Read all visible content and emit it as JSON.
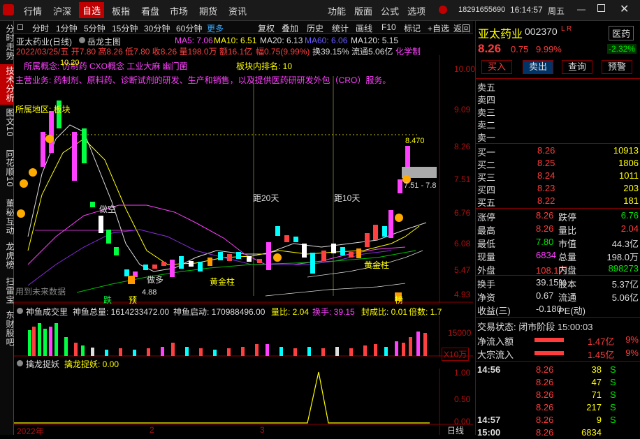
{
  "menu": {
    "items": [
      "行情",
      "沪深",
      "自选",
      "板指",
      "看盘",
      "市场",
      "期货",
      "资讯"
    ],
    "right": [
      "功能",
      "版面",
      "公式",
      "选项"
    ],
    "phone": "18291655690",
    "time": "16:14:57",
    "weekday": "周五"
  },
  "sidebar": [
    "分时走势",
    "技术分析",
    "图文10",
    "同花顺10",
    "董秘互动",
    "龙虎榜",
    "扫雷宝",
    "东财股吧"
  ],
  "timeframes": [
    "分时",
    "1分钟",
    "5分钟",
    "15分钟",
    "30分钟",
    "60分钟",
    "更多"
  ],
  "toolbar": [
    "复权",
    "叠加",
    "历史",
    "统计",
    "画线",
    "F10",
    "标记",
    "+自选",
    "返回"
  ],
  "chart": {
    "title": "亚太药业(日线)",
    "main_indicator": "岳龙主图",
    "ma5": "MA5: 7.06",
    "ma10": "MA10: 6.51",
    "ma20": "MA20: 6.13",
    "ma60": "MA60: 6.06",
    "ma120": "MA120: 5.15",
    "ohlc": "2022/03/25/五 开7.80 高8.26 低7.80 收8.26 量198.0万 额16.1亿",
    "change": "幅0.75(9.99%)",
    "turnover": "换39.15% 流通5.06亿",
    "concept": "化学制",
    "sector_line": "所属概念: 仿制药 CXO概念 工业大麻 幽门菌",
    "sector_rank": "板块内排名: 10",
    "business": "主营业务: 药制剂、原料药、诊断试剂的研发、生产和销售，以及提供医药研研发外包（CRO）服务。",
    "sector_block": "所属地区: 板块",
    "high_label": "10.20",
    "h8470": "8.470",
    "range_label": "7.51 - 7.8",
    "low_label": "4.88",
    "jin_zhu1": "黄金柱",
    "jin_zhu2": "黄金柱",
    "ju20": "距20天",
    "ju10": "距10天",
    "yu": "预",
    "die": "跌",
    "bang": "榜",
    "future": "用到未来数据",
    "zhen_kong": "做空",
    "yuan": "做多",
    "y_labels": [
      "10.00",
      "9.09",
      "8.26",
      "7.51",
      "6.76",
      "6.08",
      "5.47",
      "4.93"
    ],
    "xaxis": [
      "2022年",
      "2",
      "3"
    ]
  },
  "vol": {
    "title": "神鱼成交里",
    "total": "神鱼总量: 1614233472.00",
    "start": "神鱼启动: 170988496.00",
    "ratio": "量比: 2.04",
    "hand": "换手: 39.15",
    "seal": "封成比: 0.01",
    "mult": "倍数: 1.7",
    "y1": "15000",
    "unit": "X10万"
  },
  "ind": {
    "title": "擒龙捉妖",
    "value": "擒龙捉妖: 0.00",
    "y": [
      "1.00",
      "0.50",
      "0.00"
    ],
    "period": "日线"
  },
  "quote": {
    "name": "亚太药业",
    "code": "002370",
    "tags": "L R",
    "sector": "医药",
    "sector_pct": "-2.32%",
    "price": "8.26",
    "chg": "0.75",
    "pct": "9.99%",
    "buttons": [
      "买入",
      "卖出",
      "查询",
      "预警"
    ],
    "asks": [
      {
        "l": "卖五",
        "p": "",
        "v": ""
      },
      {
        "l": "卖四",
        "p": "",
        "v": ""
      },
      {
        "l": "卖三",
        "p": "",
        "v": ""
      },
      {
        "l": "卖二",
        "p": "",
        "v": ""
      },
      {
        "l": "卖一",
        "p": "",
        "v": ""
      }
    ],
    "bids": [
      {
        "l": "买一",
        "p": "8.26",
        "v": "10913"
      },
      {
        "l": "买二",
        "p": "8.25",
        "v": "1806"
      },
      {
        "l": "买三",
        "p": "8.24",
        "v": "1011"
      },
      {
        "l": "买四",
        "p": "8.23",
        "v": "203"
      },
      {
        "l": "买五",
        "p": "8.22",
        "v": "181"
      }
    ],
    "stats": [
      [
        "涨停",
        "8.26",
        "跌停",
        "6.76"
      ],
      [
        "最高",
        "8.26",
        "量比",
        "2.04"
      ],
      [
        "最低",
        "7.80",
        "市值",
        "44.3亿"
      ],
      [
        "现量",
        "6834",
        "总量",
        "198.0万"
      ],
      [
        "外盘",
        "108.1万",
        "内盘",
        "898273"
      ]
    ],
    "stats2": [
      [
        "换手",
        "39.15%",
        "股本",
        "5.37亿"
      ],
      [
        "净资",
        "0.67",
        "流通",
        "5.06亿"
      ],
      [
        "收益(三)",
        "-0.180",
        "PE(动)",
        ""
      ]
    ],
    "state": "交易状态: 闭市阶段 15:00:03",
    "flow": [
      {
        "l": "净流入额",
        "v": "1.47亿",
        "p": "9%"
      },
      {
        "l": "大宗流入",
        "v": "1.45亿",
        "p": "9%"
      }
    ],
    "ticks": [
      {
        "t": "14:56",
        "p": "8.26",
        "v": "38",
        "s": "S"
      },
      {
        "t": "",
        "p": "8.26",
        "v": "47",
        "s": "S"
      },
      {
        "t": "",
        "p": "8.26",
        "v": "71",
        "s": "S"
      },
      {
        "t": "",
        "p": "8.26",
        "v": "217",
        "s": "S"
      },
      {
        "t": "14:57",
        "p": "8.26",
        "v": "9",
        "s": "S"
      },
      {
        "t": "15:00",
        "p": "8.26",
        "v": "6834",
        "s": ""
      }
    ]
  }
}
